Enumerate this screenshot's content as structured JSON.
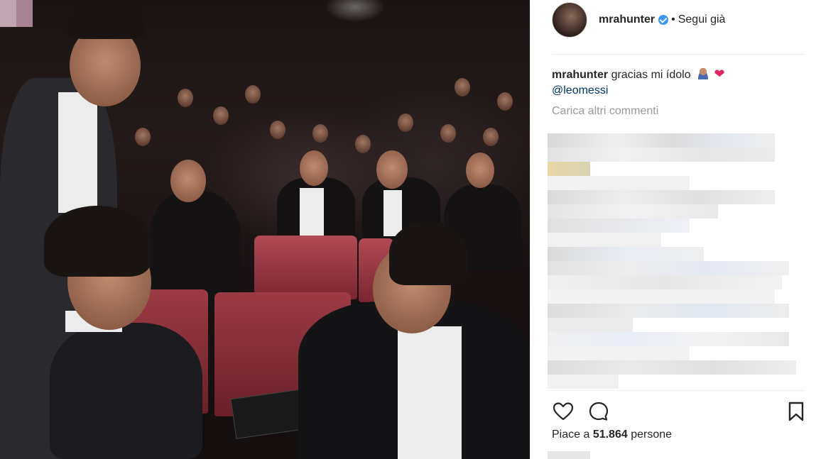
{
  "post": {
    "username": "mrahunter",
    "follow_status": "Segui già",
    "caption_username": "mrahunter",
    "caption_text": "gracias mi ídolo",
    "caption_mention": "@leomessi",
    "load_more": "Carica altri commenti",
    "likes_prefix": "Piace a ",
    "likes_count": "51.864",
    "likes_suffix": " persone"
  },
  "icons": {
    "verified": "verified-badge-icon",
    "like": "heart-outline-icon",
    "comment": "comment-bubble-icon",
    "save": "bookmark-icon",
    "emoji_person": "person-emoji-icon",
    "emoji_heart": "red-heart-emoji-icon"
  },
  "colors": {
    "text": "#262626",
    "muted": "#999999",
    "link": "#003569",
    "verified": "#3897f0",
    "heart": "#e0245e",
    "seat": "#9c3b46"
  }
}
